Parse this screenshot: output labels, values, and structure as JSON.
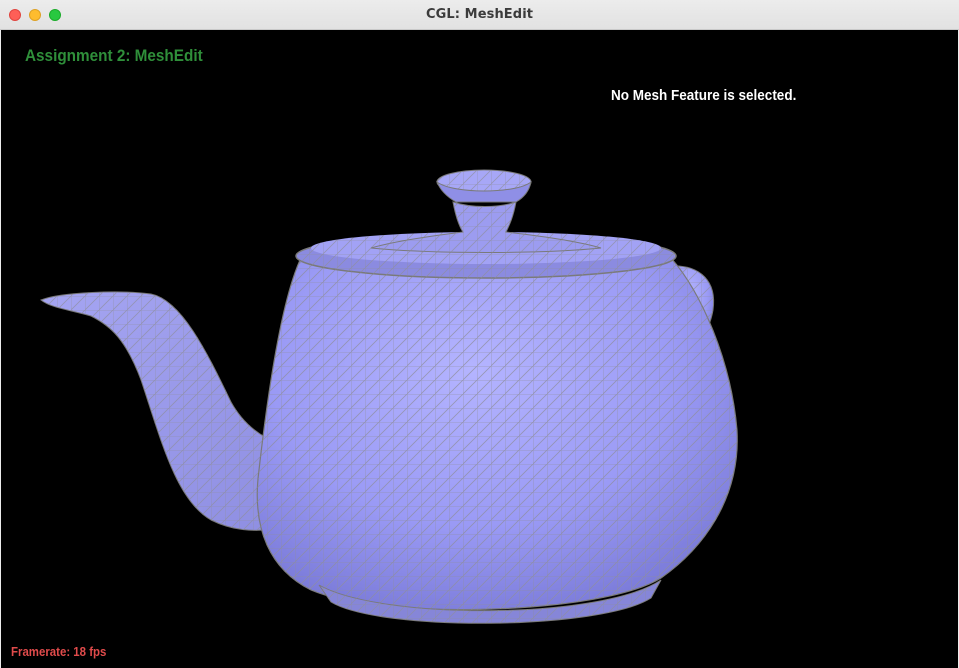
{
  "window": {
    "title": "CGL: MeshEdit",
    "background_peek_text": "..."
  },
  "overlay": {
    "assignment_title": "Assignment 2: MeshEdit",
    "status_message": "No Mesh Feature is selected.",
    "framerate_label": "Framerate: 18 fps"
  },
  "colors": {
    "mesh_fill": "#9d9dfa",
    "mesh_wire": "#8a8a8a",
    "title_green": "#2f8f3a",
    "framerate_red": "#e04b4b",
    "viewport_bg": "#000000"
  },
  "icons": {
    "close": "close-icon",
    "minimize": "minimize-icon",
    "zoom": "zoom-icon"
  }
}
